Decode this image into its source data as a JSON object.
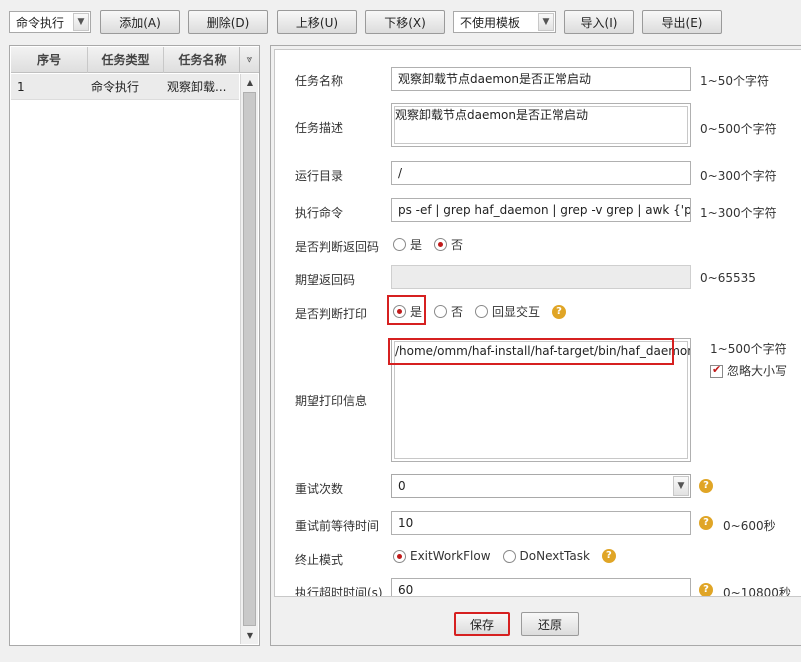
{
  "toolbar": {
    "task_type_value": "命令执行",
    "add_label": "添加(A)",
    "delete_label": "删除(D)",
    "move_up_label": "上移(U)",
    "move_down_label": "下移(X)",
    "template_value": "不使用模板",
    "import_label": "导入(I)",
    "export_label": "导出(E)"
  },
  "task_table": {
    "columns": [
      "序号",
      "任务类型",
      "任务名称"
    ],
    "rows": [
      {
        "index": "1",
        "type": "命令执行",
        "name": "观察卸载..."
      }
    ]
  },
  "form": {
    "task_name": {
      "label": "任务名称",
      "value": "观察卸载节点daemon是否正常启动",
      "hint": "1~50个字符"
    },
    "task_desc": {
      "label": "任务描述",
      "value": "观察卸载节点daemon是否正常启动",
      "hint": "0~500个字符"
    },
    "run_dir": {
      "label": "运行目录",
      "value": "/",
      "hint": "0~300个字符"
    },
    "exec_cmd": {
      "label": "执行命令",
      "value": "ps  -ef | grep haf_daemon | grep -v grep | awk {'print $",
      "hint": "1~300个字符"
    },
    "check_return": {
      "label": "是否判断返回码",
      "yes": "是",
      "no": "否",
      "selected": "否"
    },
    "expected_return": {
      "label": "期望返回码",
      "value": "",
      "hint": "0~65535"
    },
    "check_print": {
      "label": "是否判断打印",
      "yes": "是",
      "no": "否",
      "echo": "回显交互",
      "selected": "是"
    },
    "expected_print": {
      "label": "期望打印信息",
      "value": "/home/omm/haf-install/haf-target/bin/haf_daemon",
      "hint": "1~500个字符",
      "ignore_case": "忽略大小写",
      "ignore_case_checked": true
    },
    "retry_count": {
      "label": "重试次数",
      "value": "0"
    },
    "retry_wait": {
      "label": "重试前等待时间",
      "value": "10",
      "hint": "0~600秒"
    },
    "stop_mode": {
      "label": "终止模式",
      "opt1": "ExitWorkFlow",
      "opt2": "DoNextTask",
      "selected": "ExitWorkFlow"
    },
    "timeout": {
      "label": "执行超时时间(s)",
      "value": "60",
      "hint": "0~10800秒"
    }
  },
  "footer": {
    "save_label": "保存",
    "restore_label": "还原"
  },
  "colors": {
    "accent_red": "#d62020",
    "help_orange": "#e0a526"
  }
}
